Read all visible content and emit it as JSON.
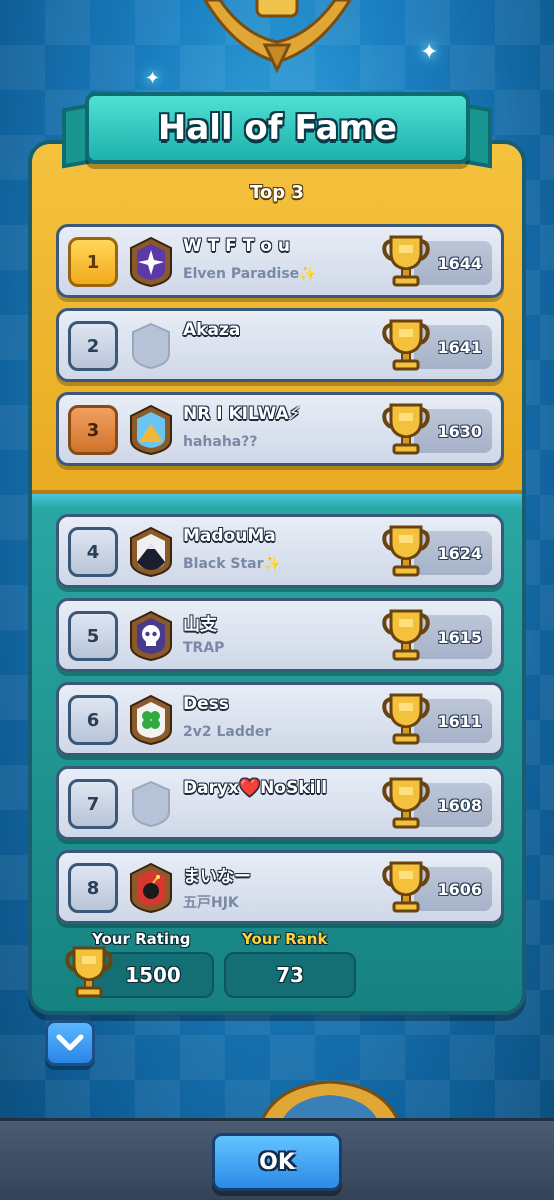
{
  "title": "Hall of Fame",
  "top_label": "Top 3",
  "players": [
    {
      "rank": "1",
      "name": "W T F  T o u",
      "clan": "Elven Paradise✨",
      "score": "1644",
      "badge": "purple-star-badge",
      "rank_style": "gold"
    },
    {
      "rank": "2",
      "name": "Akaza",
      "clan": "",
      "score": "1641",
      "badge": "empty-shield-badge",
      "rank_style": "silver"
    },
    {
      "rank": "3",
      "name": "NR I KILWA⚡",
      "clan": "hahaha??",
      "score": "1630",
      "badge": "blue-mountain-badge",
      "rank_style": "bronze"
    },
    {
      "rank": "4",
      "name": "MadouMa",
      "clan": "Black Star✨",
      "score": "1624",
      "badge": "dark-mountain-badge",
      "rank_style": "silver"
    },
    {
      "rank": "5",
      "name": "山支",
      "clan": "TRAP",
      "score": "1615",
      "badge": "skull-badge",
      "rank_style": "silver"
    },
    {
      "rank": "6",
      "name": "Dess",
      "clan": "2v2 Ladder",
      "score": "1611",
      "badge": "clover-badge",
      "rank_style": "silver"
    },
    {
      "rank": "7",
      "name": "Daryx❤️NoSkill",
      "clan": "",
      "score": "1608",
      "badge": "empty-shield-badge",
      "rank_style": "silver"
    },
    {
      "rank": "8",
      "name": "まいなー",
      "clan": "五戸HJK",
      "score": "1606",
      "badge": "bomb-badge",
      "rank_style": "silver"
    }
  ],
  "your_rating_label": "Your Rating",
  "your_rating": "1500",
  "your_rank_label": "Your Rank",
  "your_rank": "73",
  "ok_label": "OK",
  "colors": {
    "gold": "#f5c23e",
    "teal": "#1d8a8a",
    "button_blue": "#2c8ae6"
  }
}
